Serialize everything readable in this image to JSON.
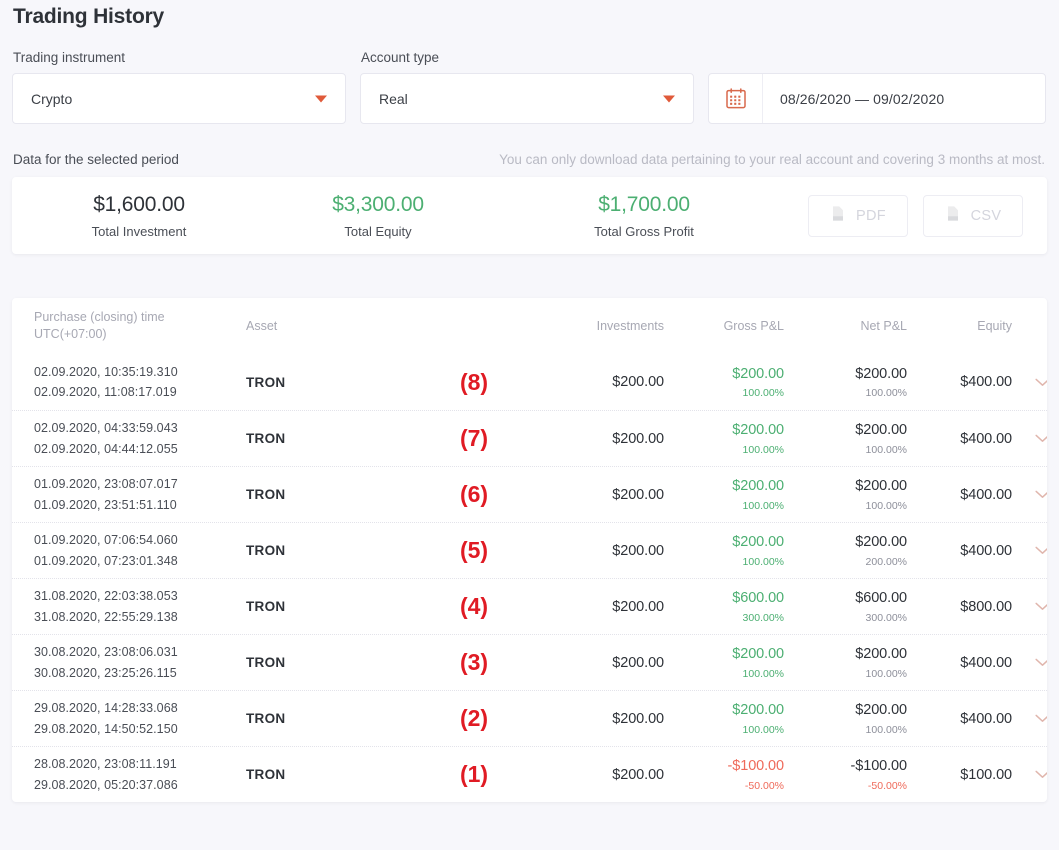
{
  "page": {
    "title": "Trading History"
  },
  "filters": {
    "instrument": {
      "label": "Trading instrument",
      "value": "Crypto"
    },
    "account": {
      "label": "Account type",
      "value": "Real"
    },
    "daterange": {
      "value": "08/26/2020 — 09/02/2020",
      "icon": "calendar-icon"
    }
  },
  "summary": {
    "heading": "Data for the selected period",
    "notice": "You can only download data pertaining to your real account and covering 3 months at most.",
    "stats": [
      {
        "value": "$1,600.00",
        "label": "Total Investment",
        "color": "dark"
      },
      {
        "value": "$3,300.00",
        "label": "Total Equity",
        "color": "green"
      },
      {
        "value": "$1,700.00",
        "label": "Total Gross Profit",
        "color": "green"
      }
    ],
    "downloads": [
      {
        "label": "PDF",
        "icon": "file-icon"
      },
      {
        "label": "CSV",
        "icon": "file-icon"
      }
    ]
  },
  "table": {
    "columns": {
      "time_line1": "Purchase (closing) time",
      "time_line2": "UTC(+07:00)",
      "asset": "Asset",
      "investments": "Investments",
      "gross": "Gross P&L",
      "net": "Net P&L",
      "equity": "Equity"
    },
    "rows": [
      {
        "annotation": "(8)",
        "open_time": "02.09.2020, 10:35:19.310",
        "close_time": "02.09.2020, 11:08:17.019",
        "asset": "TRON",
        "investments": "$200.00",
        "gross_amount": "$200.00",
        "gross_pct": "100.00%",
        "gross_sign": "positive",
        "net_amount": "$200.00",
        "net_pct": "100.00%",
        "equity": "$400.00"
      },
      {
        "annotation": "(7)",
        "open_time": "02.09.2020, 04:33:59.043",
        "close_time": "02.09.2020, 04:44:12.055",
        "asset": "TRON",
        "investments": "$200.00",
        "gross_amount": "$200.00",
        "gross_pct": "100.00%",
        "gross_sign": "positive",
        "net_amount": "$200.00",
        "net_pct": "100.00%",
        "equity": "$400.00"
      },
      {
        "annotation": "(6)",
        "open_time": "01.09.2020, 23:08:07.017",
        "close_time": "01.09.2020, 23:51:51.110",
        "asset": "TRON",
        "investments": "$200.00",
        "gross_amount": "$200.00",
        "gross_pct": "100.00%",
        "gross_sign": "positive",
        "net_amount": "$200.00",
        "net_pct": "100.00%",
        "equity": "$400.00"
      },
      {
        "annotation": "(5)",
        "open_time": "01.09.2020, 07:06:54.060",
        "close_time": "01.09.2020, 07:23:01.348",
        "asset": "TRON",
        "investments": "$200.00",
        "gross_amount": "$200.00",
        "gross_pct": "100.00%",
        "gross_sign": "positive",
        "net_amount": "$200.00",
        "net_pct": "200.00%",
        "equity": "$400.00"
      },
      {
        "annotation": "(4)",
        "open_time": "31.08.2020, 22:03:38.053",
        "close_time": "31.08.2020, 22:55:29.138",
        "asset": "TRON",
        "investments": "$200.00",
        "gross_amount": "$600.00",
        "gross_pct": "300.00%",
        "gross_sign": "positive",
        "net_amount": "$600.00",
        "net_pct": "300.00%",
        "equity": "$800.00"
      },
      {
        "annotation": "(3)",
        "open_time": "30.08.2020, 23:08:06.031",
        "close_time": "30.08.2020, 23:25:26.115",
        "asset": "TRON",
        "investments": "$200.00",
        "gross_amount": "$200.00",
        "gross_pct": "100.00%",
        "gross_sign": "positive",
        "net_amount": "$200.00",
        "net_pct": "100.00%",
        "equity": "$400.00"
      },
      {
        "annotation": "(2)",
        "open_time": "29.08.2020, 14:28:33.068",
        "close_time": "29.08.2020, 14:50:52.150",
        "asset": "TRON",
        "investments": "$200.00",
        "gross_amount": "$200.00",
        "gross_pct": "100.00%",
        "gross_sign": "positive",
        "net_amount": "$200.00",
        "net_pct": "100.00%",
        "equity": "$400.00"
      },
      {
        "annotation": "(1)",
        "open_time": "28.08.2020, 23:08:11.191",
        "close_time": "29.08.2020, 05:20:37.086",
        "asset": "TRON",
        "investments": "$200.00",
        "gross_amount": "-$100.00",
        "gross_pct": "-50.00%",
        "gross_sign": "negative",
        "net_amount": "-$100.00",
        "net_pct": "-50.00%",
        "equity": "$100.00"
      }
    ]
  },
  "colors": {
    "accent": "#e05a3a",
    "positive": "#4caf72",
    "negative": "#ef6a5a",
    "annotation": "#e01b24"
  }
}
